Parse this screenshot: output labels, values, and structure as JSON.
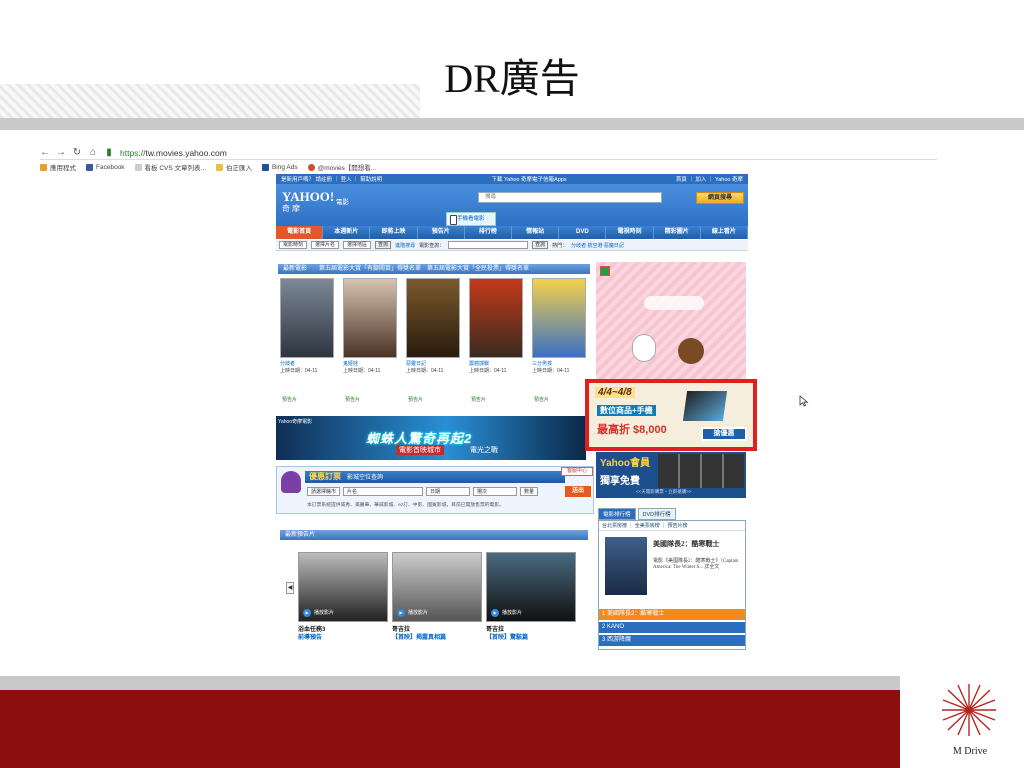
{
  "slide": {
    "title": "DR廣告"
  },
  "browser": {
    "url_secure": "https://",
    "url_host": "tw.movies.yahoo.com",
    "bookmarks": [
      "應用程式",
      "Facebook",
      "看板 CVS 文章列表...",
      "伯正匯入",
      "Bing Ads",
      "@movies【開想看..."
    ]
  },
  "site": {
    "topbar_left": "是新用戶嗎？ 請註冊 ｜ 登入 ｜ 幫助說明",
    "topbar_center": "下載 Yahoo 奇摩電子信箱Apps",
    "topbar_right": "首頁 ｜ 加入 ｜ Yahoo 奇摩",
    "logo_main": "YAHOO!",
    "logo_sub": "奇摩",
    "section": "電影",
    "search_placeholder": "搜尋",
    "search_button": "網頁搜尋",
    "app_badge": "手機看電影",
    "nav": [
      "電影首頁",
      "本週新片",
      "即將上映",
      "預告片",
      "排行榜",
      "情報站",
      "DVD",
      "電視時刻",
      "精彩圖片",
      "線上看片"
    ],
    "subnav": [
      "電影時刻",
      "選擇片名",
      "選擇地區",
      "查詢",
      "進階搜尋",
      "電影查詢：",
      "查詢",
      "熱門：",
      "分歧者 航空港 惡魔日記"
    ],
    "new_movies_header": "最新電影　　第五屆電影大賞「有腳鬧苗」得獎名單　第五屆電影大賞「全民投票」得獎名單",
    "movies": [
      {
        "name": "分歧者",
        "date": "上映日期：04-11",
        "trailer": "預告片"
      },
      {
        "name": "鬼姬娃",
        "date": "上映日期：04-11",
        "trailer": "預告片"
      },
      {
        "name": "惡靈日記",
        "date": "上映日期：04-11",
        "trailer": "預告片"
      },
      {
        "name": "震撼諜戰",
        "date": "上映日期：04-11",
        "trailer": "預告片"
      },
      {
        "name": "三分男孩",
        "date": "上映日期：04-11",
        "trailer": "預告片"
      }
    ],
    "banner": {
      "tag": "Yahoo奇摩電影",
      "line1": "蜘蛛人驚奇再起2",
      "line2": "電影首映城市",
      "line3": "電光之戰"
    },
    "booking": {
      "header_em": "優惠訂票",
      "header": "影城空位查詢",
      "help": "客服中心",
      "fields": [
        "請選擇縣市",
        "片名",
        "日期",
        "場次",
        "數量"
      ],
      "go": "送出",
      "note": "本訂票系統提供威秀、美麗華、華威影城、ez訂、中影、國賓影城，目前已開放售票的電影。"
    },
    "trailers_header": "最新預告片",
    "trailers": [
      {
        "play": "播放影片",
        "title": "浴血任務3",
        "sub": "前導預告"
      },
      {
        "play": "播放影片",
        "title": "哥吉拉",
        "sub": "【首映】揭露真相篇"
      },
      {
        "play": "播放影片",
        "title": "哥吉拉",
        "sub": "【首映】驚駭篇"
      }
    ],
    "ad_highlight": {
      "date": "4/4~4/8",
      "line1": "數位商品+手機",
      "line2": "最高折 $8,000",
      "cta": "搶優惠"
    },
    "member": {
      "line1": "Yahoo會員",
      "line2": "獨享免費",
      "line3": "<<天電影購票・立即搶購>>"
    },
    "rank_tabs": [
      "電影排行榜",
      "DVD排行榜"
    ],
    "rank_sub": "台北票房榜 ｜ 全美票房榜 ｜ 預告片榜",
    "rank_feature_title": "美國隊長2：酷寒戰士",
    "rank_feature_desc": "電影《美國隊長2：酷寒戰士》（Captain America: The Winter S... 詳全文",
    "rank_list": [
      "1 美國隊長2：酷寒戰士",
      "2 KANO",
      "3 西游降魔"
    ]
  },
  "footer": {
    "brand": "M Drive"
  }
}
